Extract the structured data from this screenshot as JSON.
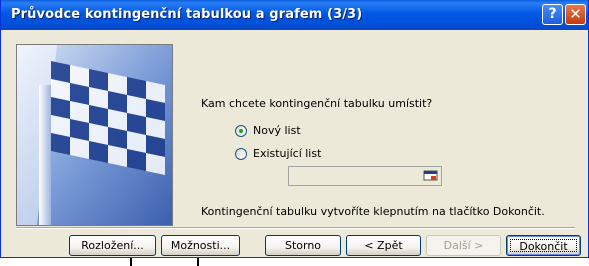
{
  "window": {
    "title": "Průvodce kontingenční tabulkou a grafem (3/3)",
    "help_button": "?",
    "close_button": "✕"
  },
  "main": {
    "question": "Kam chcete kontingenční tabulku umístit?",
    "options": [
      {
        "label": "Nový list",
        "selected": true
      },
      {
        "label": "Existující list",
        "selected": false
      }
    ],
    "range_value": "",
    "instruction": "Kontingenční tabulku vytvoříte klepnutím na tlačítko Dokončit."
  },
  "buttons": {
    "layout": "Rozložení...",
    "options": "Možnosti...",
    "cancel": "Storno",
    "back": "< Zpět",
    "next": "Další >",
    "finish": "Dokončit"
  },
  "colors": {
    "titlebar": "#0058e6",
    "dialog_bg": "#ece9d8",
    "flag_dark": "#1f3f8f",
    "flag_light": "#ffffff"
  }
}
